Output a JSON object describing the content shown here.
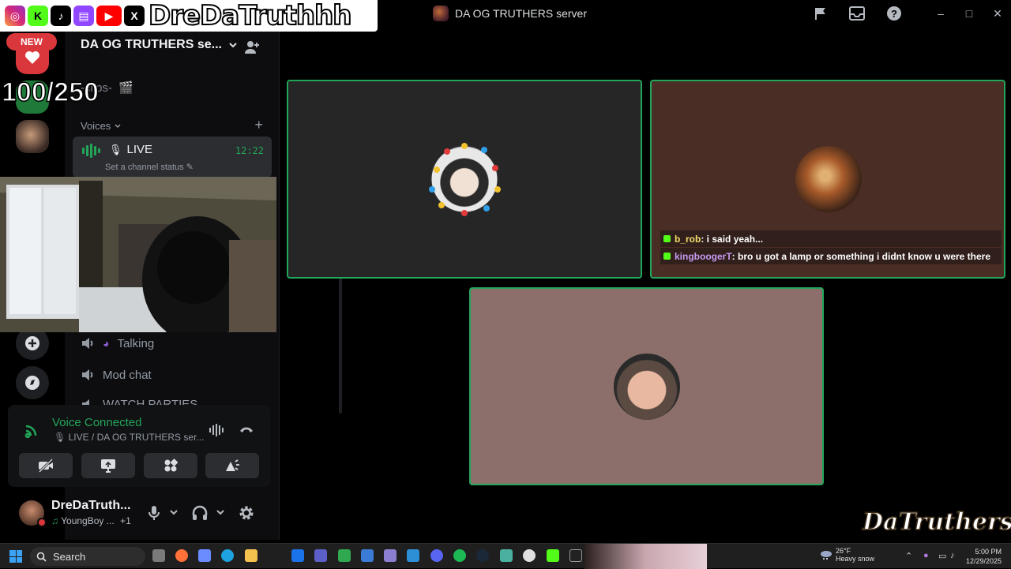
{
  "window": {
    "title": "DA OG TRUTHERS server"
  },
  "overlay": {
    "handle": "DreDaTruthhh",
    "new_badge": "NEW",
    "goal": "100/250",
    "watermark": "DaTruthers"
  },
  "channel_panel": {
    "server_name": "DA OG TRUTHERS se...",
    "clips_channel": "-clips-",
    "voices_category": "Voices",
    "live_channel": {
      "name": "LIVE",
      "time": "12:22",
      "status": "Set a channel status"
    },
    "voice_channels": [
      "Talking",
      "Mod chat",
      "WATCH PARTIES"
    ]
  },
  "voice_panel": {
    "status": "Voice Connected",
    "location": "LIVE / DA OG TRUTHERS ser..."
  },
  "user_panel": {
    "name": "DreDaTruth...",
    "activity": "YoungBoy ...",
    "activity_extra": "+1"
  },
  "chat_overlay": [
    {
      "user": "b_rob",
      "user_color": "#f5e06b",
      "message": " : i said yeah..."
    },
    {
      "user": "kingboogerT",
      "user_color": "#c79bf2",
      "message": " : bro u got a lamp or something i didnt know u were there"
    }
  ],
  "taskbar": {
    "search": "Search",
    "weather_temp": "26°F",
    "weather_desc": "Heavy snow",
    "time": "5:00 PM",
    "date": "12/29/2025"
  },
  "colors": {
    "speaking_border": "#23a55a",
    "tile1_bg": "#262626",
    "tile2_bg": "#4a2d24",
    "tile3_bg": "#8c6f6a"
  }
}
